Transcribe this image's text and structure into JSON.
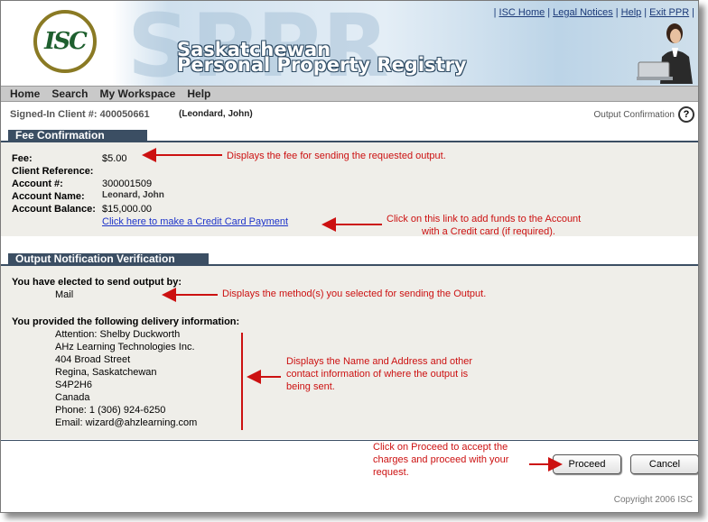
{
  "header": {
    "logo_text": "ISC",
    "watermark": "SPPR",
    "title_line1": "Saskatchewan",
    "title_line2": "Personal Property Registry",
    "links": [
      "ISC Home",
      "Legal Notices",
      "Help",
      "Exit PPR"
    ]
  },
  "menu": [
    "Home",
    "Search",
    "My Workspace",
    "Help"
  ],
  "client": {
    "label": "Signed-In Client #: 400050661",
    "name": "(Leondard, John)",
    "page_name": "Output Confirmation",
    "help_icon": "?"
  },
  "fee": {
    "heading": "Fee Confirmation",
    "fee_label": "Fee:",
    "fee_value": "$5.00",
    "client_ref_label": "Client Reference:",
    "account_label": "Account #:",
    "account_value": "300001509",
    "account_name_label": "Account Name:",
    "account_name_value": "Leonard, John",
    "balance_label": "Account Balance:",
    "balance_value": "$15,000.00",
    "credit_link": "Click here to make a Credit Card Payment"
  },
  "verification": {
    "heading": "Output Notification Verification",
    "elected_label": "You have elected to send output by:",
    "method": "Mail",
    "delivery_label": "You provided the following delivery information:",
    "address": [
      "Attention: Shelby Duckworth",
      "AHz Learning Technologies Inc.",
      "404 Broad Street",
      "Regina, Saskatchewan",
      "S4P2H6",
      "Canada",
      "Phone: 1 (306) 924-6250",
      "Email: wizard@ahzlearning.com"
    ]
  },
  "annotations": {
    "fee_note": "Displays the fee for sending the requested output.",
    "credit_note_1": "Click on this link to add funds to the Account",
    "credit_note_2": "with a Credit card (if required).",
    "method_note": "Displays the method(s) you selected for sending the Output.",
    "address_note_1": "Displays the Name and Address and other",
    "address_note_2": "contact information of where the output is",
    "address_note_3": "being sent.",
    "proceed_note_1": "Click on Proceed to accept the",
    "proceed_note_2": "charges and proceed with your",
    "proceed_note_3": "request."
  },
  "buttons": {
    "proceed": "Proceed",
    "cancel": "Cancel"
  },
  "footer": {
    "copyright": "Copyright 2006 ISC"
  },
  "colors": {
    "annotation": "#cc1111",
    "section_header": "#3b4e63",
    "link": "#1d33c9"
  }
}
